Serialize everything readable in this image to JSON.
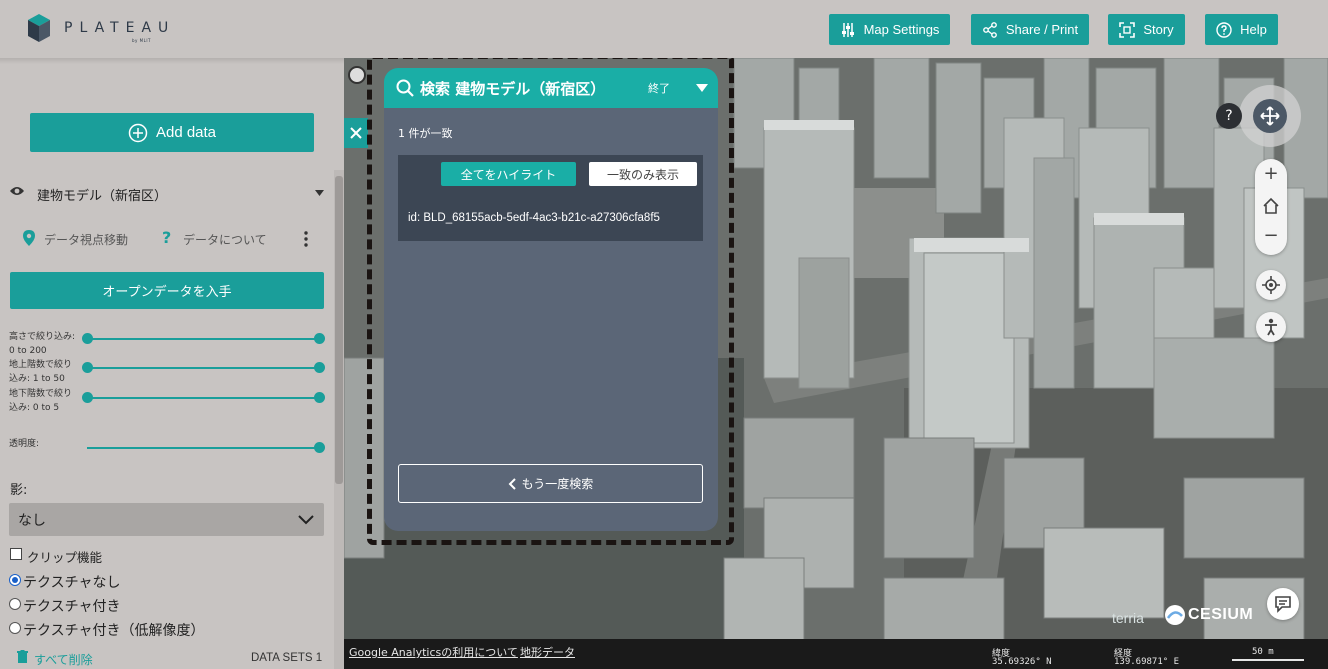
{
  "header": {
    "logo_text": "PLATEAU",
    "logo_sub": "by MLIT",
    "buttons": {
      "map_settings": "Map Settings",
      "share_print": "Share / Print",
      "story": "Story",
      "help": "Help"
    }
  },
  "left_panel": {
    "add_data": "Add data",
    "dataset_title": "建物モデル（新宿区）",
    "zoom_to_data": "データ視点移動",
    "about_data": "データについて",
    "open_data": "オープンデータを入手",
    "filters": [
      {
        "label_line1": "高さで絞り込み:",
        "label_line2": "0 to 200"
      },
      {
        "label_line1": "地上階数で絞り",
        "label_line2": "込み: 1 to 50"
      },
      {
        "label_line1": "地下階数で絞り",
        "label_line2": "込み: 0 to 5"
      }
    ],
    "opacity_label": "透明度:",
    "shadow_label": "影:",
    "shadow_value": "なし",
    "clip_label": "クリップ機能",
    "texture_options": [
      "テクスチャなし",
      "テクスチャ付き",
      "テクスチャ付き（低解像度）"
    ],
    "texture_selected": 0,
    "remove_all": "すべて削除",
    "datasets_count": "DATA SETS 1"
  },
  "search_dialog": {
    "title": "検索 建物モデル（新宿区）",
    "end_label": "終了",
    "match_count": "1 件が一致",
    "highlight_all": "全てをハイライト",
    "match_only": "一致のみ表示",
    "result_id": "id: BLD_68155acb-5edf-4ac3-b21c-a27306cfa8f5",
    "search_again": "もう一度検索"
  },
  "map": {
    "help_glyph": "?",
    "zoom_in": "+",
    "zoom_out": "−",
    "credit_terria": "terria",
    "credit_cesium": "CESIUM"
  },
  "bottom_bar": {
    "ga_text": "Google Analyticsの利用について",
    "terrain_text": "地形データ",
    "lat_label": "緯度",
    "lat_value": "35.69326° N",
    "lon_label": "経度",
    "lon_value": "139.69871° E",
    "scale_label": "50 m"
  },
  "colors": {
    "accent": "#1a9e9a",
    "dialog_bg": "#5b6677",
    "dialog_header": "#1aaea6",
    "panel_bg": "#c8c4c2"
  }
}
